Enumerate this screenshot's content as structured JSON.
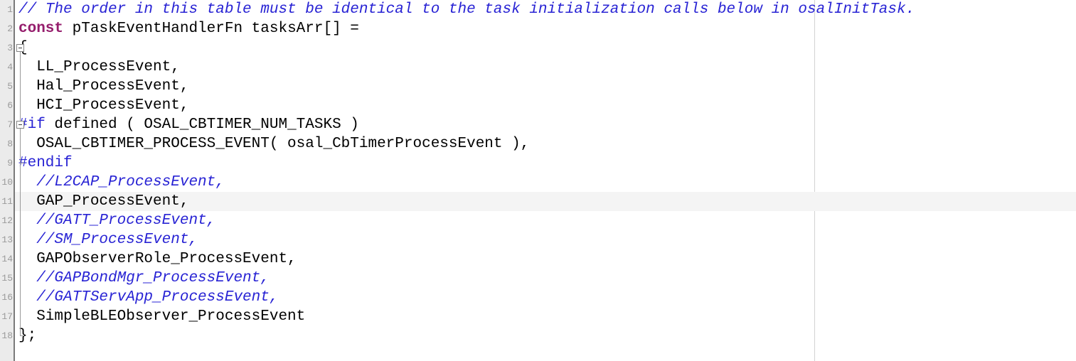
{
  "editor": {
    "name": "source-code-editor",
    "language": "C",
    "colors": {
      "background": "#ffffff",
      "gutter_background": "#ebebeb",
      "gutter_border": "#7a7a7a",
      "current_line_highlight": "#f4f4f4",
      "margin_ruler": "#d2d2d2",
      "comment": "#2823d4",
      "keyword": "#951d6c",
      "preprocessor": "#2823d4",
      "plain_text": "#000000",
      "line_number": "#9a9a9a"
    },
    "margin_ruler_x": 1145,
    "current_line_index": 9
  },
  "lines": [
    {
      "number": "1",
      "current": false,
      "fold": "none",
      "tokens": [
        {
          "kind": "comment",
          "text": "// The order in this table must be identical to the task initialization calls below in osalInitTask."
        }
      ]
    },
    {
      "number": "2",
      "current": false,
      "fold": "none",
      "tokens": [
        {
          "kind": "keyword",
          "text": "const"
        },
        {
          "kind": "plain",
          "text": " pTaskEventHandlerFn tasksArr[] ="
        }
      ]
    },
    {
      "number": "3",
      "current": false,
      "fold": "start",
      "tokens": [
        {
          "kind": "plain",
          "text": "{"
        }
      ]
    },
    {
      "number": "4",
      "current": false,
      "fold": "body",
      "tokens": [
        {
          "kind": "plain",
          "text": "  LL_ProcessEvent,"
        }
      ]
    },
    {
      "number": "5",
      "current": false,
      "fold": "body",
      "tokens": [
        {
          "kind": "plain",
          "text": "  Hal_ProcessEvent,"
        }
      ]
    },
    {
      "number": "6",
      "current": false,
      "fold": "body",
      "tokens": [
        {
          "kind": "plain",
          "text": "  HCI_ProcessEvent,"
        }
      ]
    },
    {
      "number": "7",
      "current": false,
      "fold": "start",
      "tokens": [
        {
          "kind": "preproc",
          "text": "#if"
        },
        {
          "kind": "plain",
          "text": " defined ( OSAL_CBTIMER_NUM_TASKS )"
        }
      ]
    },
    {
      "number": "8",
      "current": false,
      "fold": "body",
      "tokens": [
        {
          "kind": "plain",
          "text": "  OSAL_CBTIMER_PROCESS_EVENT( osal_CbTimerProcessEvent ),"
        }
      ]
    },
    {
      "number": "9",
      "current": false,
      "fold": "end",
      "tokens": [
        {
          "kind": "preproc",
          "text": "#endif"
        }
      ]
    },
    {
      "number": "10",
      "current": false,
      "fold": "body",
      "tokens": [
        {
          "kind": "comment",
          "text": "  //L2CAP_ProcessEvent,"
        }
      ]
    },
    {
      "number": "11",
      "current": true,
      "fold": "body",
      "tokens": [
        {
          "kind": "plain",
          "text": "  GAP_ProcessEvent,"
        }
      ]
    },
    {
      "number": "12",
      "current": false,
      "fold": "body",
      "tokens": [
        {
          "kind": "comment",
          "text": "  //GATT_ProcessEvent,"
        }
      ]
    },
    {
      "number": "13",
      "current": false,
      "fold": "body",
      "tokens": [
        {
          "kind": "comment",
          "text": "  //SM_ProcessEvent,"
        }
      ]
    },
    {
      "number": "14",
      "current": false,
      "fold": "body",
      "tokens": [
        {
          "kind": "plain",
          "text": "  GAPObserverRole_ProcessEvent,"
        }
      ]
    },
    {
      "number": "15",
      "current": false,
      "fold": "body",
      "tokens": [
        {
          "kind": "comment",
          "text": "  //GAPBondMgr_ProcessEvent,"
        }
      ]
    },
    {
      "number": "16",
      "current": false,
      "fold": "body",
      "tokens": [
        {
          "kind": "comment",
          "text": "  //GATTServApp_ProcessEvent,"
        }
      ]
    },
    {
      "number": "17",
      "current": false,
      "fold": "body",
      "tokens": [
        {
          "kind": "plain",
          "text": "  SimpleBLEObserver_ProcessEvent"
        }
      ]
    },
    {
      "number": "18",
      "current": false,
      "fold": "end",
      "tokens": [
        {
          "kind": "plain",
          "text": "};"
        }
      ]
    }
  ]
}
